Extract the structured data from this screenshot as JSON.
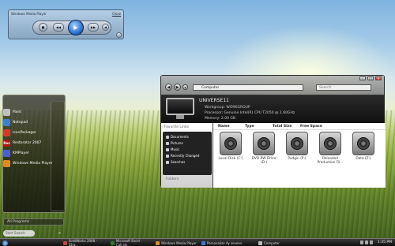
{
  "wmp": {
    "title": "Windows Media Player",
    "close_label": "Close"
  },
  "start_menu": {
    "items": [
      {
        "label": "Paint",
        "icon": "paint-icon",
        "color": "#c0c0c0"
      },
      {
        "label": "Notepad",
        "icon": "notepad-icon",
        "color": "#3f7fcf"
      },
      {
        "label": "IconPackager",
        "icon": "iconpackager-icon",
        "color": "#d33a2a"
      },
      {
        "label": "Restorator 2007",
        "icon": "restorator-icon",
        "color": "#b31414",
        "glyph": "Res"
      },
      {
        "label": "KMPlayer",
        "icon": "kmplayer-icon",
        "color": "#4a5fd6"
      },
      {
        "label": "Windows Media Player",
        "icon": "wmp-icon",
        "color": "#e08a20"
      }
    ],
    "all_programs": "All Programs",
    "search_placeholder": "Start Search"
  },
  "explorer": {
    "address": "Computer",
    "search_placeholder": "Search",
    "computer_name": "UNIVERSE11",
    "workgroup": "Workgroup: WORKGROUP",
    "processor": "Processor: Genuine Intel(R) CPU      T2050  @ 1.60GHz",
    "memory": "Memory: 2.00 GB",
    "favorite_links_title": "Favorite Links",
    "favorites": [
      "Documents",
      "Pictures",
      "Music",
      "Recently Changed",
      "Searches"
    ],
    "folders_label": "Folders",
    "columns": [
      "Name",
      "Type",
      "Total Size",
      "Free Space"
    ],
    "drives": [
      {
        "label": "Local Disk (C:)",
        "icon": "hard-disk-icon"
      },
      {
        "label": "DVD RW Drive (D:)",
        "icon": "dvd-rw-drive-icon"
      },
      {
        "label": "Pedgin (P:)",
        "icon": "disk-drive-icon"
      },
      {
        "label": "Reloaded Production Fil...",
        "icon": "disk-drive-icon"
      },
      {
        "label": "Data (Z:)",
        "icon": "disk-drive-icon"
      }
    ]
  },
  "taskbar": {
    "items": [
      {
        "label": "SolidWorks 2008 - [Dra...",
        "color": "#c43"
      },
      {
        "label": "Microsoft Excel - Call.xls",
        "color": "#2a7a2a"
      },
      {
        "label": "Windows Media Player",
        "color": "#e08a20"
      },
      {
        "label": "Personalize Ay sevens",
        "color": "#3a7ad0"
      },
      {
        "label": "Computer",
        "color": "#bbb"
      }
    ],
    "clock": "1:35 PM"
  }
}
